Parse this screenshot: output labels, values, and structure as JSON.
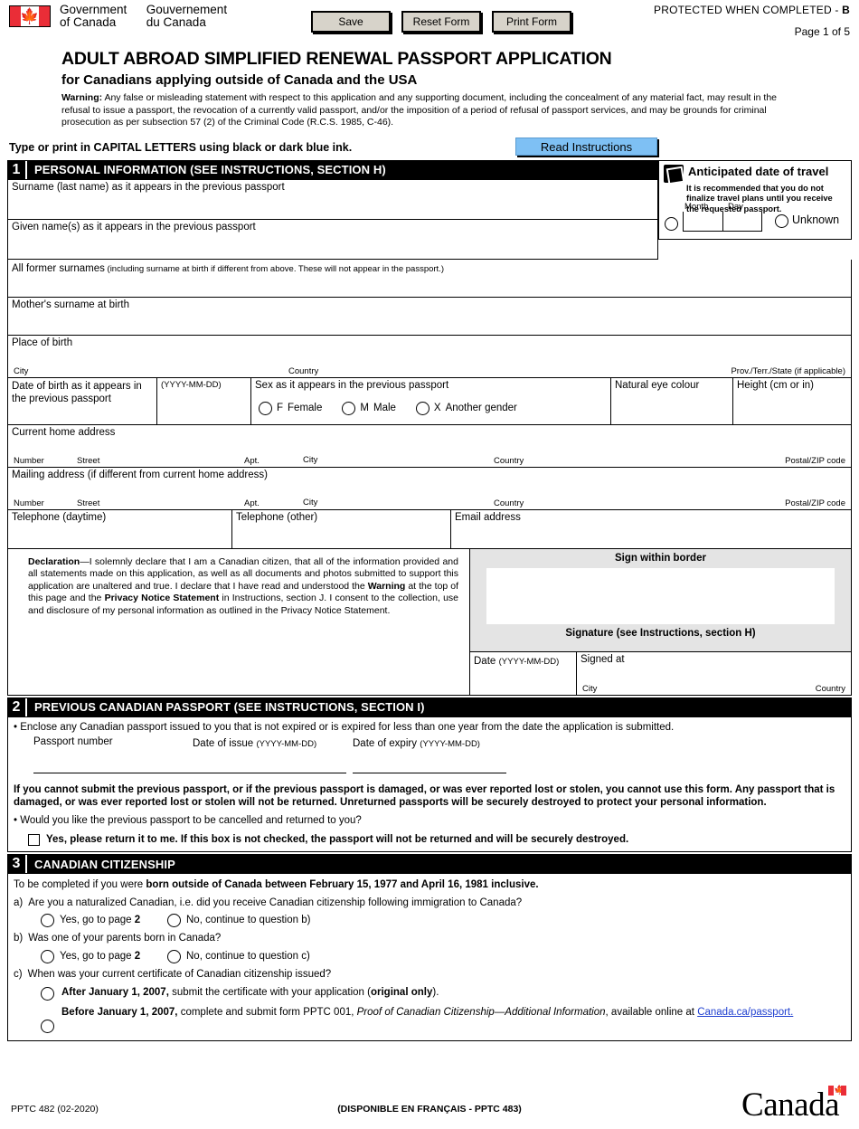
{
  "header": {
    "gov_en": "Government\nof Canada",
    "gov_en_l1": "Government",
    "gov_en_l2": "of Canada",
    "gov_fr_l1": "Gouvernement",
    "gov_fr_l2": "du Canada",
    "protected_text": "PROTECTED WHEN COMPLETED - ",
    "protected_level": "B",
    "page_label": "Page 1 of 5",
    "buttons": [
      {
        "label": "Save",
        "name": "save-button"
      },
      {
        "label": "Reset Form",
        "name": "reset-form-button"
      },
      {
        "label": "Print Form",
        "name": "print-form-button"
      }
    ]
  },
  "title": {
    "main": "ADULT ABROAD SIMPLIFIED RENEWAL PASSPORT APPLICATION",
    "sub": "for Canadians applying outside of Canada and the USA",
    "warning_label": "Warning:",
    "warning_body": " Any false or misleading statement with respect to this application and any supporting document, including the concealment of any material fact, may result in the refusal to issue a passport, the revocation of a currently valid passport, and/or the imposition of a period of refusal of passport services, and may be grounds for criminal prosecution as per subsection 57 (2) of the Criminal Code (R.C.S. 1985, C-46)."
  },
  "instructions": {
    "print_note": "Type or print in CAPITAL LETTERS using black or dark blue ink.",
    "read_button": "Read Instructions"
  },
  "section1": {
    "number": "1",
    "heading": "PERSONAL INFORMATION (SEE INSTRUCTIONS, SECTION H)",
    "surname_label": "Surname (last name) as it appears in the previous passport",
    "given_label": "Given name(s) as it appears in the previous passport",
    "former_label": "All former surnames",
    "former_note": " (including surname at birth if different from above. These will not appear in the passport.)",
    "mother_label": "Mother's surname at birth",
    "place_of_birth_label": "Place of birth",
    "pob_city": "City",
    "pob_country": "Country",
    "pob_prov": "Prov./Terr./State (if applicable)",
    "dob_label": "Date of birth as it appears in the previous passport",
    "dob_format": "(YYYY-MM-DD)",
    "sex_label": "Sex as it appears in the previous passport",
    "sex_options": [
      {
        "code": "F",
        "label": "Female"
      },
      {
        "code": "M",
        "label": "Male"
      },
      {
        "code": "X",
        "label": "Another gender"
      }
    ],
    "eye_label": "Natural eye colour",
    "height_label": "Height (cm or in)",
    "home_address_label": "Current home address",
    "mailing_address_label": "Mailing address (if different from current home address)",
    "address_subfields": [
      "Number",
      "Street",
      "Apt.",
      "City",
      "Country",
      "Postal/ZIP code"
    ],
    "tel_day_label": "Telephone (daytime)",
    "tel_other_label": "Telephone (other)",
    "email_label": "Email address",
    "travel": {
      "title": "Anticipated date of travel",
      "note": "It is recommended that you do not finalize travel plans until you receive the requested passport.",
      "month_label": "Month",
      "day_label": "Day",
      "unknown_label": "Unknown"
    }
  },
  "declaration": {
    "label": "Declaration",
    "dash": "—",
    "p1": "I solemnly declare that I am a Canadian citizen, that all of the information provided and all statements made on this application, as well as all documents and photos submitted to support this application are unaltered and true. I declare that I have read and understood the ",
    "warning_word": "Warning",
    "p2": " at the top of this page and the ",
    "privacy_word": "Privacy Notice Statement",
    "p3": " in Instructions, section J. I consent to the collection, use and disclosure of my personal information as outlined in the Privacy Notice Statement.",
    "sign_within_border": "Sign within border",
    "signature_caption": "Signature (see Instructions, section H)",
    "date_label": "Date",
    "date_format": "(YYYY-MM-DD)",
    "signed_at_label": "Signed at",
    "signed_city": "City",
    "signed_country": "Country"
  },
  "section2": {
    "number": "2",
    "heading": "PREVIOUS CANADIAN PASSPORT (SEE INSTRUCTIONS, SECTION I)",
    "bullet1": "• Enclose any Canadian passport issued to you that is not expired or is expired for less than one year from the date the application is submitted.",
    "passport_number_label": "Passport number",
    "date_issue_label": "Date of issue",
    "date_issue_format": "(YYYY-MM-DD)",
    "date_expiry_label": "Date of expiry",
    "date_expiry_format": "(YYYY-MM-DD)",
    "warning_block": "If you cannot submit the previous passport, or if the previous passport is damaged, or was ever reported lost or stolen, you cannot use this form. Any passport that is damaged, or was ever reported lost or stolen will not be returned. Unreturned passports will be securely destroyed to protect your personal information.",
    "bullet2": "• Would you like the previous passport to be cancelled and returned to you?",
    "checkbox_label": "Yes, please return it to me. If this box is not checked, the passport will not be returned and will be securely destroyed."
  },
  "section3": {
    "number": "3",
    "heading": "CANADIAN CITIZENSHIP",
    "intro_prefix": "To be completed if you were ",
    "intro_bold": "born outside of Canada between February 15, 1977 and April 16, 1981 inclusive.",
    "qa_label": "a)",
    "qa_text": "Are you a naturalized Canadian, i.e. did you receive Canadian citizenship following immigration to Canada?",
    "qa_yes_prefix": "Yes, go to page ",
    "qa_yes_page": "2",
    "qa_no": "No, continue to question b)",
    "qb_label": "b)",
    "qb_text": "Was one of your parents born in Canada?",
    "qb_yes_prefix": "Yes, go to page ",
    "qb_yes_page": "2",
    "qb_no": "No, continue to question c)",
    "qc_label": "c)",
    "qc_text": "When was your current certificate of Canadian citizenship issued?",
    "opt_after_bold": "After January 1, 2007,",
    "opt_after_rest": " submit the certificate with your application (",
    "opt_after_bold2": "original only",
    "opt_after_end": ").",
    "opt_before_bold": "Before January 1, 2007,",
    "opt_before_rest": " complete and submit form PPTC 001, ",
    "opt_before_ital": "Proof of Canadian Citizenship—Additional Information",
    "opt_before_rest2": ", available online at ",
    "opt_before_link": "Canada.ca/passport."
  },
  "footer": {
    "form_code": "PPTC 482 (02-2020)",
    "french_note": "(DISPONIBLE EN FRANÇAIS - PPTC 483)",
    "wordmark": "Canada"
  },
  "colors": {
    "read_button_bg": "#7ec0f4",
    "toolbar_button_bg": "#d7d3ca",
    "section_bar_bg": "#000000",
    "signature_panel_bg": "#e4e4e4",
    "flag_red": "#ea2d37",
    "link_blue": "#2040d0"
  }
}
